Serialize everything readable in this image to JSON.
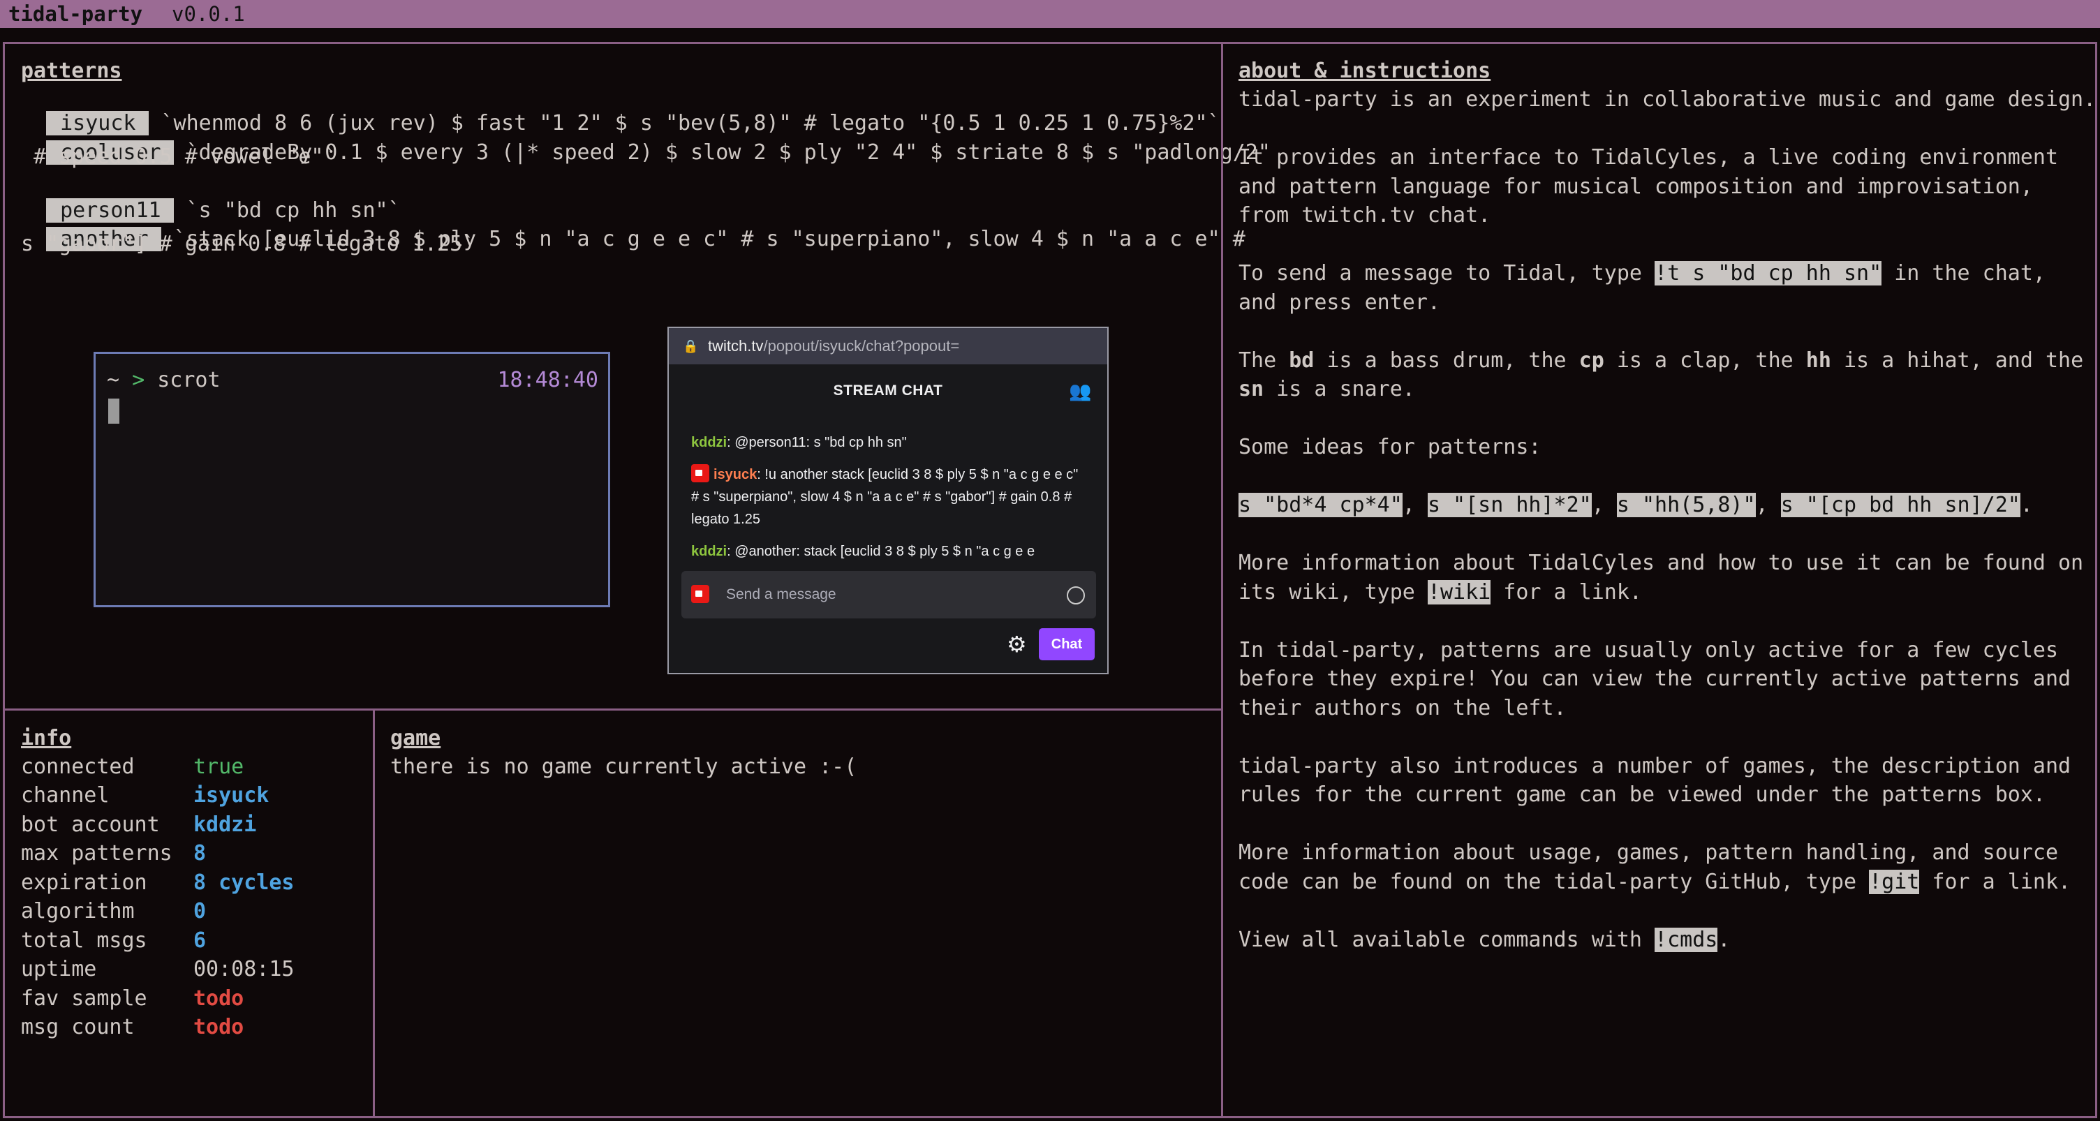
{
  "app": {
    "name": "tidal-party",
    "version": "v0.0.1"
  },
  "patterns": {
    "title": "patterns",
    "rows": [
      {
        "user": "isyuck",
        "code": "`whenmod 8 6 (jux rev) $ fast \"1 2\" $ s \"bev(5,8)\" # legato \"{0.5 1 0.25 1 0.75}%2\"`"
      },
      {
        "user": "cooluser",
        "code": "`degradeBy 0.1 $ every 3 (|* speed 2) $ slow 2 $ ply \"2 4\" $ striate 8 $ s \"padlong/2\"",
        "cont": " # speed 0.5 # vowel \"e\"`"
      },
      {
        "user": "person11",
        "code": "`s \"bd cp hh sn\"`"
      },
      {
        "user": "another",
        "code": "`stack [euclid 3 8 $ ply 5 $ n \"a c g e e c\" # s \"superpiano\", slow 4 $ n \"a a c e\" #",
        "cont": "s \"gabor\"] # gain 0.8 # legato 1.25`"
      }
    ]
  },
  "terminal": {
    "tilde": "~",
    "arrow": ">",
    "command": "scrot",
    "time": "18:48:40"
  },
  "twitch": {
    "url_host": "twitch.tv",
    "url_path": "/popout/isyuck/chat?popout=",
    "header": "STREAM CHAT",
    "messages": [
      {
        "nick": "kddzi",
        "text": ": @person11: s \"bd cp hh sn\""
      },
      {
        "nick": "isyuck",
        "text": ": !u another stack [euclid 3 8 $ ply 5 $ n \"a c g e e c\" # s \"superpiano\", slow 4 $ n \"a a c e\" # s \"gabor\"] # gain 0.8 # legato 1.25"
      },
      {
        "nick": "kddzi",
        "text": ": @another: stack [euclid 3 8 $ ply 5 $ n \"a c g e e"
      }
    ],
    "input_placeholder": "Send a message",
    "chat_button": "Chat"
  },
  "info": {
    "title": "info",
    "rows": [
      {
        "key": "connected",
        "value": "true",
        "style": "green"
      },
      {
        "key": "channel",
        "value": "isyuck",
        "style": "blue"
      },
      {
        "key": "bot account",
        "value": "kddzi",
        "style": "blue"
      },
      {
        "key": "max patterns",
        "value": "8",
        "style": "blue"
      },
      {
        "key": "expiration",
        "value": "8 cycles",
        "style": "blue"
      },
      {
        "key": "algorithm",
        "value": "0",
        "style": "blue"
      },
      {
        "key": "total msgs",
        "value": "6",
        "style": "blue"
      },
      {
        "key": "uptime",
        "value": "00:08:15",
        "style": "plain"
      },
      {
        "key": "fav sample",
        "value": "todo",
        "style": "red"
      },
      {
        "key": "msg count",
        "value": "todo",
        "style": "red"
      }
    ]
  },
  "game": {
    "title": "game",
    "status": "there is no game currently active :-("
  },
  "about": {
    "title": "about & instructions",
    "p1": "tidal-party is an experiment in collaborative music and game design.",
    "p2": "It provides an interface to TidalCyles, a live coding environment\nand pattern language for musical composition and improvisation,\nfrom twitch.tv chat.",
    "p3a": "To send a message to Tidal, type ",
    "p3cmd": "!t s \"bd cp hh sn\"",
    "p3b": " in the chat,\nand press enter.",
    "p4": {
      "t1": "The ",
      "b1": "bd",
      "t2": " is a bass drum, the ",
      "b2": "cp",
      "t3": " is a clap, the ",
      "b3": "hh",
      "t4": " is a hihat, and the\n",
      "b4": "sn",
      "t5": " is a snare."
    },
    "p5": "Some ideas for patterns:",
    "ideas": [
      "s \"bd*4 cp*4\"",
      "s \"[sn hh]*2\"",
      "s \"hh(5,8)\"",
      "s \"[cp bd hh sn]/2\""
    ],
    "p6a": "More information about TidalCyles and how to use it can be found on\nits wiki, type ",
    "p6cmd": "!wiki",
    "p6b": " for a link.",
    "p7": "In tidal-party, patterns are usually only active for a few cycles\nbefore they expire! You can view the currently active patterns and\ntheir authors on the left.",
    "p8": "tidal-party also introduces a number of games, the description and\nrules for the current game can be viewed under the patterns box.",
    "p9a": "More information about usage, games, pattern handling, and source\ncode can be found on the tidal-party GitHub, type ",
    "p9cmd": "!git",
    "p9b": " for a link.",
    "p10a": "View all available commands with ",
    "p10cmd": "!cmds",
    "p10b": "."
  },
  "colors": {
    "border": "#8a5f85",
    "titlebar": "#9b6b94",
    "accent_purple": "#9147ff",
    "true": "#53b86a",
    "value": "#4fa3e0",
    "todo": "#e24b43"
  }
}
